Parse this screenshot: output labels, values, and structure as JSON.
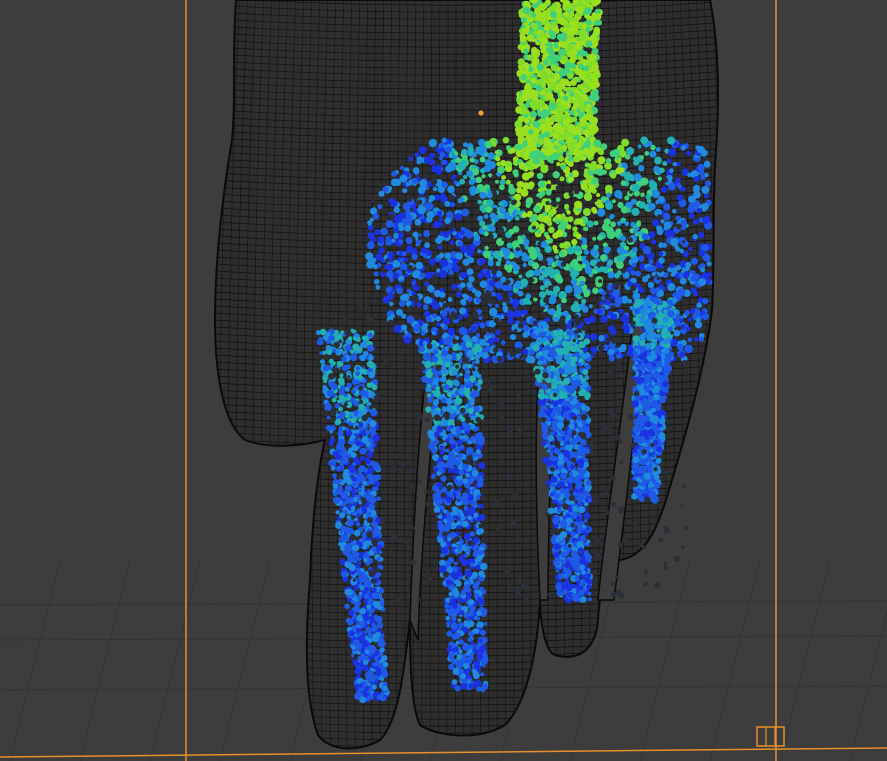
{
  "viewport": {
    "background_color": "#3d3d3d",
    "grid_color": "#353535",
    "bounds_color": "#e8902c",
    "wire_color": "#0a0a0a"
  },
  "objects": {
    "hand_mesh": {
      "display": "wireframe"
    },
    "fluid_particles": {
      "colors": [
        "#1a32e0",
        "#1e5ae6",
        "#1f8ae0",
        "#22b0b0",
        "#3fd07a",
        "#7fdc2a",
        "#9be01e"
      ]
    },
    "domain_bounds": {
      "display": "bounds"
    },
    "object_origin": {
      "color": "#f0a030"
    },
    "empty_handle": {
      "icon": "cage-icon"
    }
  }
}
